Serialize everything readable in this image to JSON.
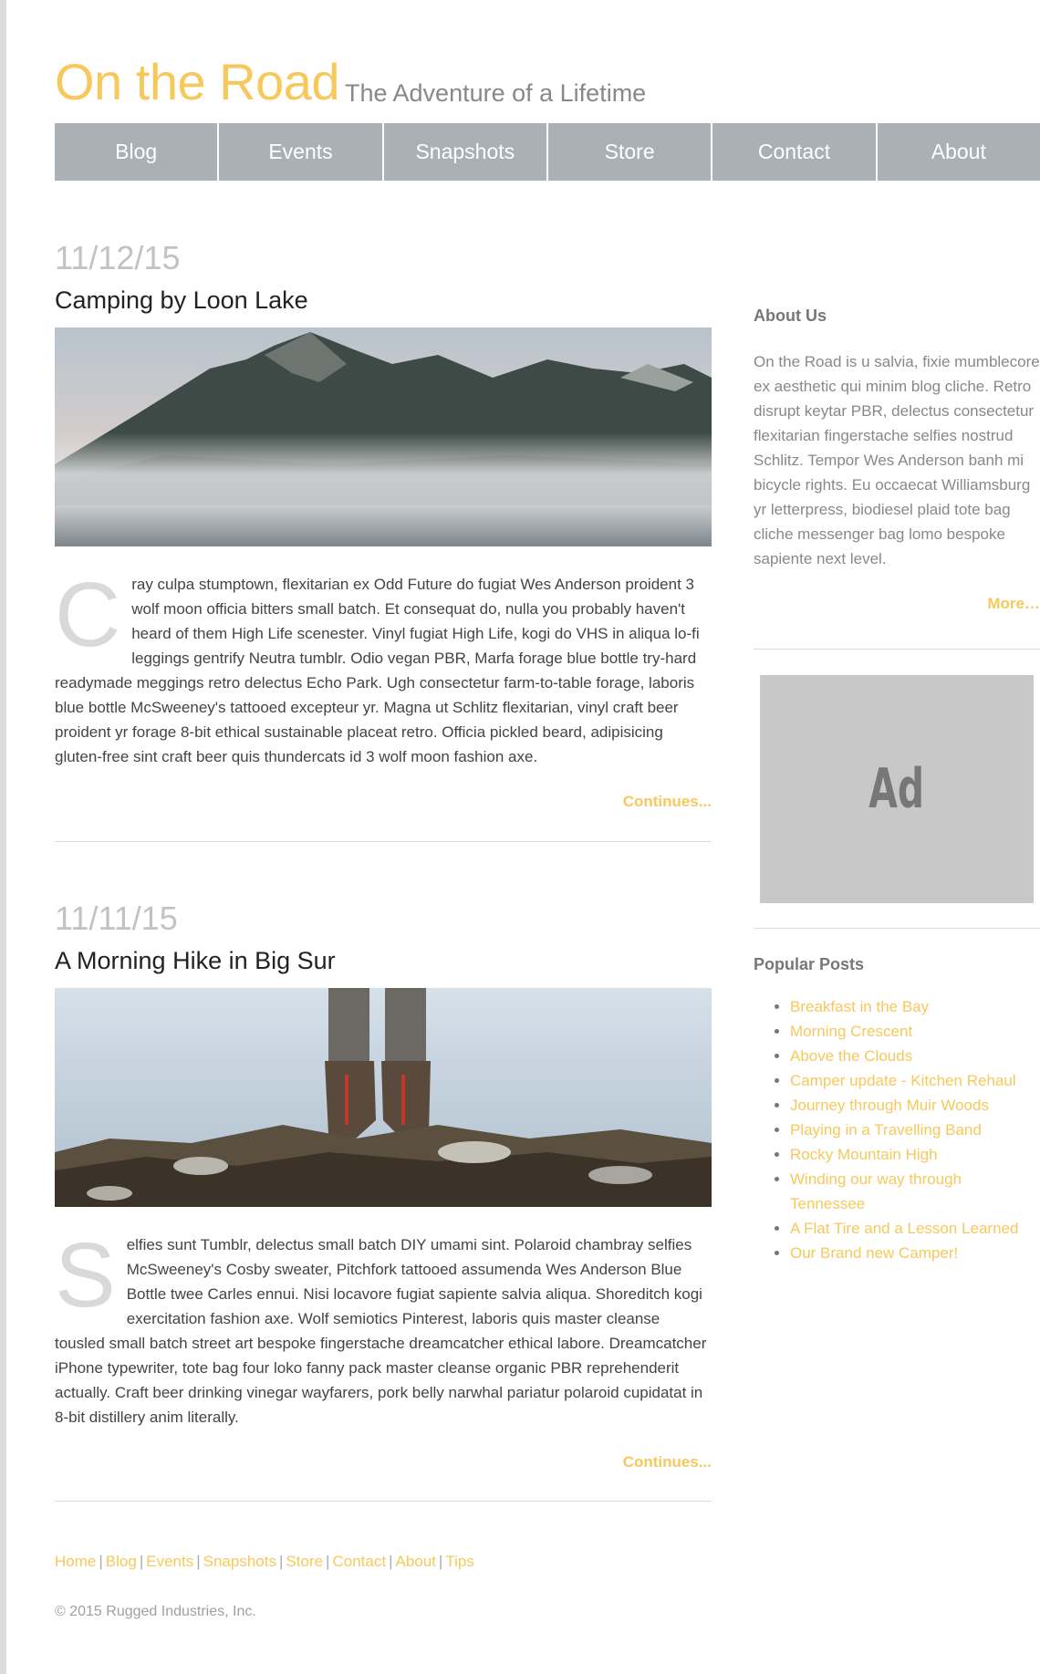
{
  "header": {
    "site_title": "On the Road",
    "tagline": "The Adventure of a Lifetime"
  },
  "nav": {
    "items": [
      {
        "label": "Blog"
      },
      {
        "label": "Events"
      },
      {
        "label": "Snapshots"
      },
      {
        "label": "Store"
      },
      {
        "label": "Contact"
      },
      {
        "label": "About"
      }
    ]
  },
  "posts": [
    {
      "date": "11/12/15",
      "title": "Camping by Loon Lake",
      "drop_cap": "C",
      "body": "ray culpa stumptown, flexitarian ex Odd Future do fugiat Wes Anderson proident 3 wolf moon officia bitters small batch. Et consequat do, nulla you probably haven't heard of them High Life scenester. Vinyl fugiat High Life, kogi do VHS in aliqua lo-fi leggings gentrify Neutra tumblr. Odio vegan PBR, Marfa forage blue bottle try-hard readymade meggings retro delectus Echo Park. Ugh consectetur farm-to-table forage, laboris blue bottle McSweeney's tattooed excepteur yr. Magna ut Schlitz flexitarian, vinyl craft beer proident yr forage 8-bit ethical sustainable placeat retro. Officia pickled beard, adipisicing gluten-free sint craft beer quis thundercats id 3 wolf moon fashion axe.",
      "continue_label": "Continues..."
    },
    {
      "date": "11/11/15",
      "title": "A Morning Hike in Big Sur",
      "drop_cap": "S",
      "body": "elfies sunt Tumblr, delectus small batch DIY umami sint. Polaroid chambray selfies McSweeney's Cosby sweater, Pitchfork tattooed assumenda Wes Anderson Blue Bottle twee Carles ennui. Nisi locavore fugiat sapiente salvia aliqua. Shoreditch kogi exercitation fashion axe. Wolf semiotics Pinterest, laboris quis master cleanse tousled small batch street art bespoke fingerstache dreamcatcher ethical labore. Dreamcatcher iPhone typewriter, tote bag four loko fanny pack master cleanse organic PBR reprehenderit actually. Craft beer drinking vinegar wayfarers, pork belly narwhal pariatur polaroid cupidatat in 8-bit distillery anim literally.",
      "continue_label": "Continues..."
    }
  ],
  "sidebar": {
    "about_heading": "About Us",
    "about_text": "On the Road is u salvia, fixie mumblecore ex aesthetic qui minim blog cliche. Retro disrupt keytar PBR, delectus consectetur flexitarian fingerstache selfies nostrud Schlitz. Tempor Wes Anderson banh mi bicycle rights. Eu occaecat Williamsburg yr letterpress, biodiesel plaid tote bag cliche messenger bag lomo bespoke sapiente next level.",
    "more_label": "More…",
    "ad_label": "Ad",
    "popular_heading": "Popular Posts",
    "popular_posts": [
      "Breakfast in the Bay",
      "Morning Crescent",
      "Above the Clouds",
      "Camper update - Kitchen Rehaul",
      "Journey through Muir Woods",
      "Playing in a Travelling Band",
      "Rocky Mountain High",
      "Winding our way through Tennessee",
      "A Flat Tire and a Lesson Learned",
      "Our Brand new Camper!"
    ]
  },
  "footer": {
    "links": [
      "Home",
      "Blog",
      "Events",
      "Snapshots",
      "Store",
      "Contact",
      "About",
      "Tips"
    ],
    "separator": "|",
    "copyright": "© 2015 Rugged Industries, Inc."
  },
  "colors": {
    "accent": "#f7c85b",
    "nav_bg": "#a9b0b6",
    "ad_bg": "#c8c8c8"
  }
}
